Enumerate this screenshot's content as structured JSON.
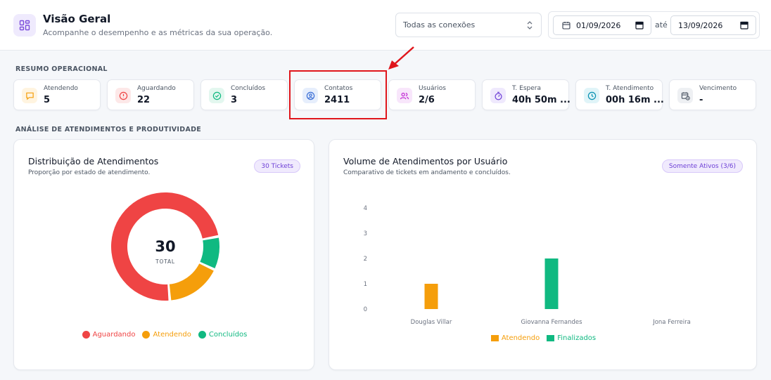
{
  "header": {
    "title": "Visão Geral",
    "subtitle": "Acompanhe o desempenho e as métricas da sua operação.",
    "connection_select": "Todas as conexões",
    "date_from": "01/09/2026",
    "date_sep": "até",
    "date_to": "13/09/2026"
  },
  "sections": {
    "summary": "RESUMO OPERACIONAL",
    "analysis": "ANÁLISE DE ATENDIMENTOS E PRODUTIVIDADE"
  },
  "cards": [
    {
      "label": "Atendendo",
      "value": "5",
      "icon": "chat-icon",
      "color": "#f59e0b",
      "bg": "#fff4e0"
    },
    {
      "label": "Aguardando",
      "value": "22",
      "icon": "alert-icon",
      "color": "#ef4444",
      "bg": "#fde8e8"
    },
    {
      "label": "Concluídos",
      "value": "3",
      "icon": "check-circle-icon",
      "color": "#10b981",
      "bg": "#e3f7ef"
    },
    {
      "label": "Contatos",
      "value": "2411",
      "icon": "user-circle-icon",
      "color": "#3b6fd6",
      "bg": "#e6eefc"
    },
    {
      "label": "Usuários",
      "value": "2/6",
      "icon": "users-icon",
      "color": "#c026d3",
      "bg": "#f8e6fb"
    },
    {
      "label": "T. Espera",
      "value": "40h 50m ...",
      "icon": "stopwatch-icon",
      "color": "#6d3fd6",
      "bg": "#efe9fd"
    },
    {
      "label": "T. Atendimento",
      "value": "00h 16m ...",
      "icon": "clock-icon",
      "color": "#0891b2",
      "bg": "#e0f4f8"
    },
    {
      "label": "Vencimento",
      "value": "-",
      "icon": "calendar-clock-icon",
      "color": "#4b5563",
      "bg": "#eef0f3"
    }
  ],
  "donut_panel": {
    "title": "Distribuição de Atendimentos",
    "subtitle": "Proporção por estado de atendimento.",
    "pill": "30 Tickets",
    "center_value": "30",
    "center_label": "TOTAL"
  },
  "bar_panel": {
    "title": "Volume de Atendimentos por Usuário",
    "subtitle": "Comparativo de tickets em andamento e concluídos.",
    "pill": "Somente Ativos (3/6)"
  },
  "chart_data": [
    {
      "type": "pie",
      "total": 30,
      "slices": [
        {
          "name": "Aguardando",
          "value": 22,
          "color": "#ef4444"
        },
        {
          "name": "Atendendo",
          "value": 5,
          "color": "#f59e0b"
        },
        {
          "name": "Concluídos",
          "value": 3,
          "color": "#10b981"
        }
      ]
    },
    {
      "type": "bar",
      "categories": [
        "Douglas Villar",
        "Giovanna Fernandes",
        "Jona Ferreira"
      ],
      "series": [
        {
          "name": "Atendendo",
          "values": [
            1,
            0,
            0
          ],
          "color": "#f59e0b"
        },
        {
          "name": "Finalizados",
          "values": [
            0,
            2,
            0
          ],
          "color": "#10b981"
        }
      ],
      "ylim": [
        0,
        4
      ],
      "yticks": [
        0,
        1,
        2,
        3,
        4
      ],
      "grid": false
    }
  ]
}
